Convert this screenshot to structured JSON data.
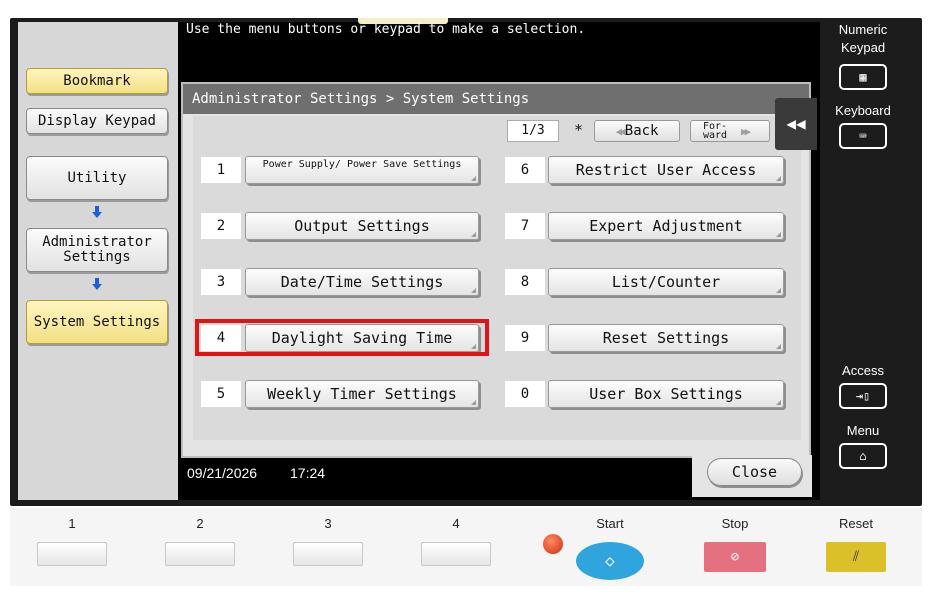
{
  "message": "Use the menu buttons or keypad to make a selection.",
  "left_panel": {
    "bookmark": "Bookmark",
    "display_keypad": "Display Keypad",
    "utility": "Utility",
    "administrator_settings": "Administrator Settings",
    "system_settings": "System Settings"
  },
  "panel": {
    "breadcrumb": "Administrator Settings > System Settings",
    "page": "1/3",
    "star": "*",
    "back": "Back",
    "forward": "For-ward",
    "collapse_icon": "double-chevron-left-icon"
  },
  "menu_left": [
    {
      "num": "1",
      "label": "Power Supply/ Power Save Settings"
    },
    {
      "num": "2",
      "label": "Output Settings"
    },
    {
      "num": "3",
      "label": "Date/Time Settings"
    },
    {
      "num": "4",
      "label": "Daylight Saving Time"
    },
    {
      "num": "5",
      "label": "Weekly Timer Settings"
    }
  ],
  "menu_right": [
    {
      "num": "6",
      "label": "Restrict User Access"
    },
    {
      "num": "7",
      "label": "Expert Adjustment"
    },
    {
      "num": "8",
      "label": "List/Counter"
    },
    {
      "num": "9",
      "label": "Reset Settings"
    },
    {
      "num": "0",
      "label": "User Box Settings"
    }
  ],
  "status": {
    "date": "09/21/2026",
    "time": "17:24"
  },
  "close": "Close",
  "right_panel": {
    "numeric_keypad": "Numeric Keypad",
    "keyboard": "Keyboard",
    "access": "Access",
    "menu": "Menu"
  },
  "hardware": {
    "keys": [
      "1",
      "2",
      "3",
      "4"
    ],
    "start": "Start",
    "stop": "Stop",
    "reset": "Reset"
  },
  "colors": {
    "highlight": "#e01414",
    "start": "#30a4dc",
    "stop": "#e57080",
    "reset": "#dcc02a"
  }
}
